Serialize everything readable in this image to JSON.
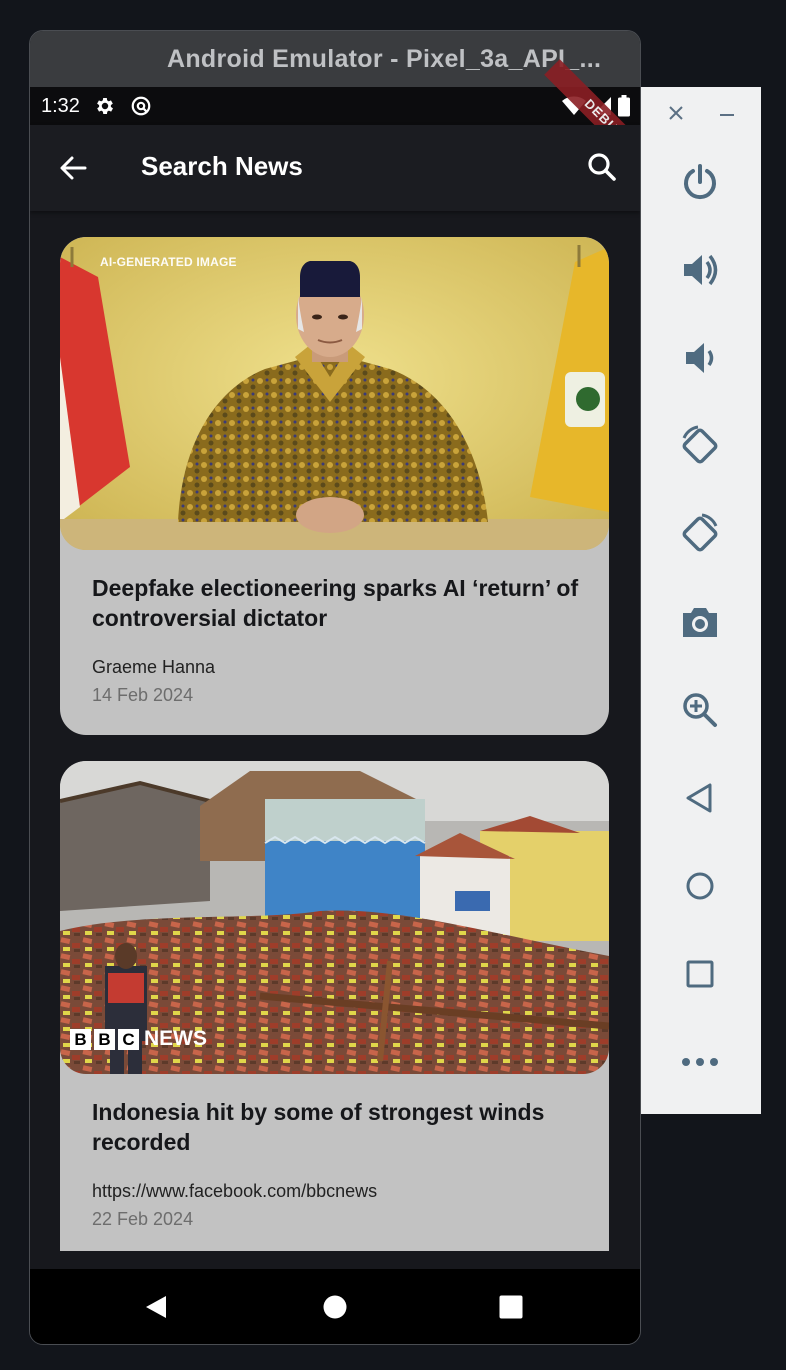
{
  "window": {
    "title": "Android Emulator - Pixel_3a_API_..."
  },
  "status_bar": {
    "time": "1:32",
    "debug_label": "DEBUG"
  },
  "app_bar": {
    "title": "Search News"
  },
  "articles": [
    {
      "title": "Deepfake electioneering sparks AI ‘return’ of controversial dictator",
      "author": "Graeme Hanna",
      "date": "14 Feb 2024",
      "image_caption": "AI-GENERATED IMAGE"
    },
    {
      "title": "Indonesia hit by some of strongest winds recorded",
      "author": "https://www.facebook.com/bbcnews",
      "date": "22 Feb 2024",
      "image_logo": "NEWS",
      "image_logo_letters": [
        "B",
        "B",
        "C"
      ]
    }
  ],
  "toolbar": {
    "icons": [
      "power-icon",
      "volume-up-icon",
      "volume-down-icon",
      "rotate-left-icon",
      "rotate-right-icon",
      "camera-icon",
      "zoom-icon",
      "back-icon",
      "home-icon",
      "overview-icon",
      "more-icon"
    ]
  },
  "colors": {
    "app_background": "#17181d",
    "card_background": "#c2c2c2",
    "toolbar_icon": "#4f6b80",
    "debug_ribbon": "#8b1e24"
  }
}
